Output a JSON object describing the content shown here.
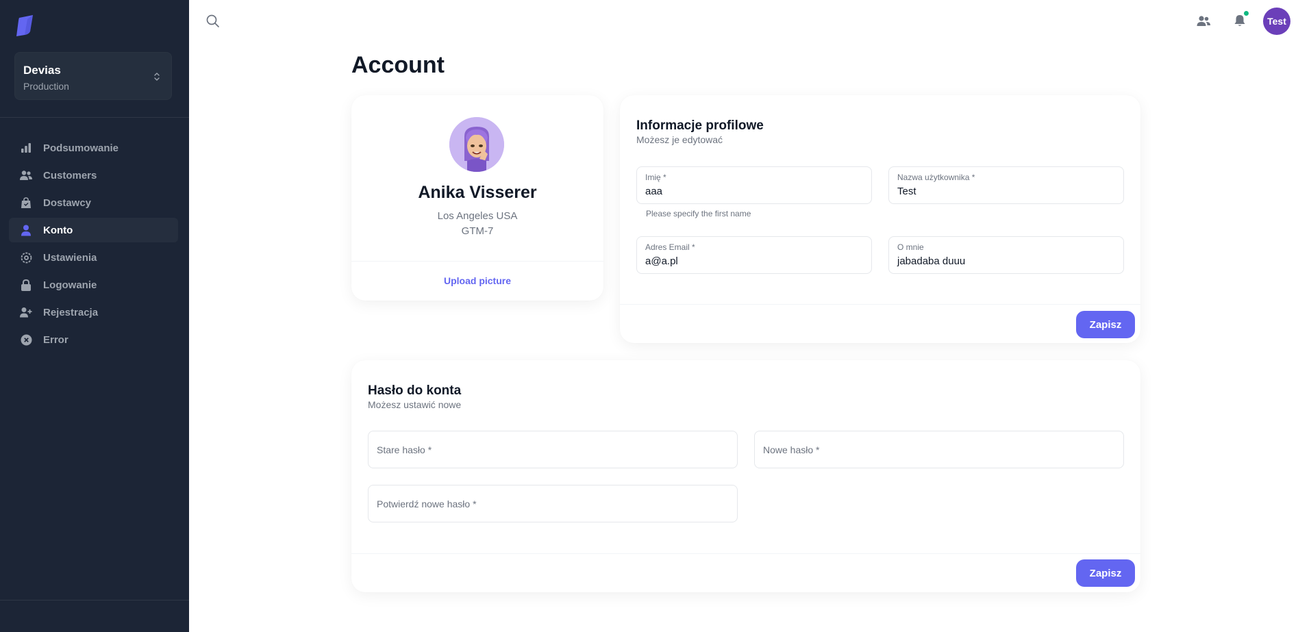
{
  "sidebar": {
    "workspace": {
      "name": "Devias",
      "env": "Production"
    },
    "items": [
      {
        "label": "Podsumowanie",
        "icon": "chart-bar-icon",
        "active": false
      },
      {
        "label": "Customers",
        "icon": "users-icon",
        "active": false
      },
      {
        "label": "Dostawcy",
        "icon": "shopping-bag-icon",
        "active": false
      },
      {
        "label": "Konto",
        "icon": "user-icon",
        "active": true
      },
      {
        "label": "Ustawienia",
        "icon": "cog-icon",
        "active": false
      },
      {
        "label": "Logowanie",
        "icon": "lock-icon",
        "active": false
      },
      {
        "label": "Rejestracja",
        "icon": "user-plus-icon",
        "active": false
      },
      {
        "label": "Error",
        "icon": "x-circle-icon",
        "active": false
      }
    ]
  },
  "topbar": {
    "avatar_text": "Test",
    "notification_dot_color": "#10b981"
  },
  "page": {
    "title": "Account"
  },
  "profile": {
    "name": "Anika Visserer",
    "city": "Los Angeles USA",
    "timezone": "GTM-7",
    "upload_label": "Upload picture"
  },
  "info": {
    "title": "Informacje profilowe",
    "subtitle": "Możesz je edytować",
    "first_name": {
      "label": "Imię *",
      "value": "aaa",
      "helper": "Please specify the first name"
    },
    "username": {
      "label": "Nazwa użytkownika *",
      "value": "Test"
    },
    "email": {
      "label": "Adres Email *",
      "value": "a@a.pl"
    },
    "about": {
      "label": "O mnie",
      "value": "jabadaba duuu"
    },
    "save_label": "Zapisz"
  },
  "password": {
    "title": "Hasło do konta",
    "subtitle": "Możesz ustawić nowe",
    "old_placeholder": "Stare hasło *",
    "new_placeholder": "Nowe hasło *",
    "confirm_placeholder": "Potwierdź nowe hasło *",
    "save_label": "Zapisz"
  },
  "colors": {
    "accent": "#6366f1",
    "sidebar_bg": "#1c2536"
  }
}
